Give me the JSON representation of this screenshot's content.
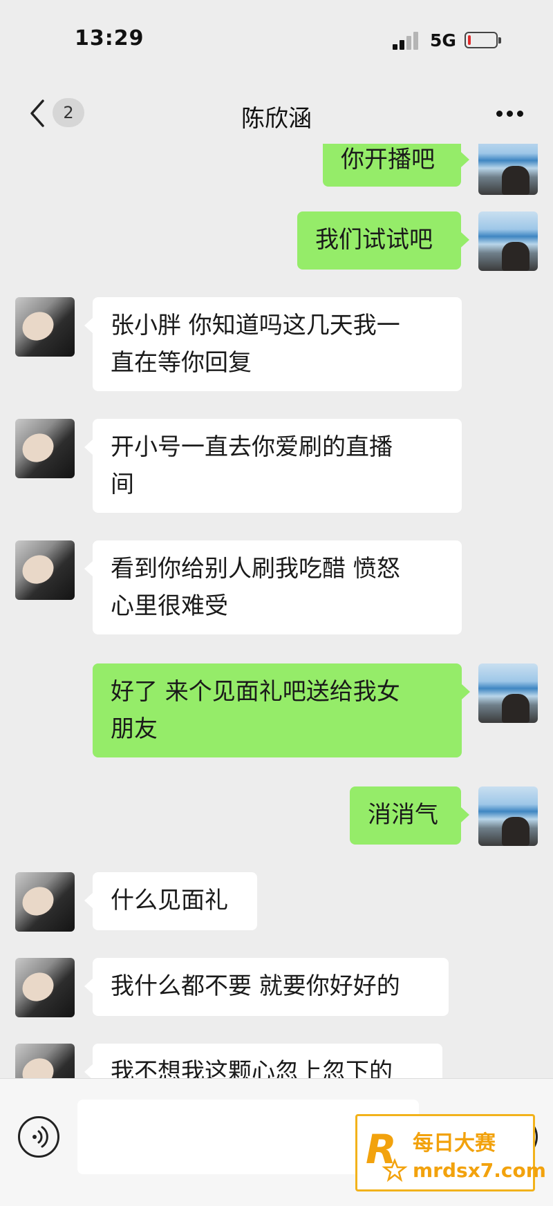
{
  "status_bar": {
    "time": "13:29",
    "network": "5G",
    "battery_level": 0.08,
    "battery_color": "#e02b2b"
  },
  "nav": {
    "back_icon": "chevron-left-icon",
    "unread_count": "2",
    "title": "陈欣涵",
    "more_icon": "more-dots-icon"
  },
  "colors": {
    "background": "#ededed",
    "outgoing_bubble": "#95ec69",
    "incoming_bubble": "#ffffff",
    "watermark_accent": "#f2a20d"
  },
  "messages": [
    {
      "sender": "me",
      "text": "你开播吧",
      "partially_visible": true
    },
    {
      "sender": "me",
      "text": "我们试试吧"
    },
    {
      "sender": "contact",
      "lines": [
        "张小胖 你知道吗这几天我一",
        "直在等你回复"
      ]
    },
    {
      "sender": "contact",
      "lines": [
        "开小号一直去你爱刷的直播",
        "间"
      ]
    },
    {
      "sender": "contact",
      "lines": [
        "看到你给别人刷我吃醋 愤怒",
        "心里很难受"
      ]
    },
    {
      "sender": "me",
      "lines": [
        "好了 来个见面礼吧送给我女",
        "朋友"
      ]
    },
    {
      "sender": "me",
      "text": "消消气"
    },
    {
      "sender": "contact",
      "text": "什么见面礼"
    },
    {
      "sender": "contact",
      "text": "我什么都不要 就要你好好的"
    },
    {
      "sender": "contact",
      "text": "我不想我这颗心忽上忽下的",
      "partially_visible": true
    }
  ],
  "input_bar": {
    "voice_icon": "voice-wave-icon",
    "mic_icon": "microphone-icon",
    "emoji_icon": "smiley-icon",
    "plus_icon": "plus-icon",
    "input_value": ""
  },
  "watermark": {
    "logo_letter": "R",
    "title": "每日大赛",
    "url": "mrdsx7.com"
  }
}
